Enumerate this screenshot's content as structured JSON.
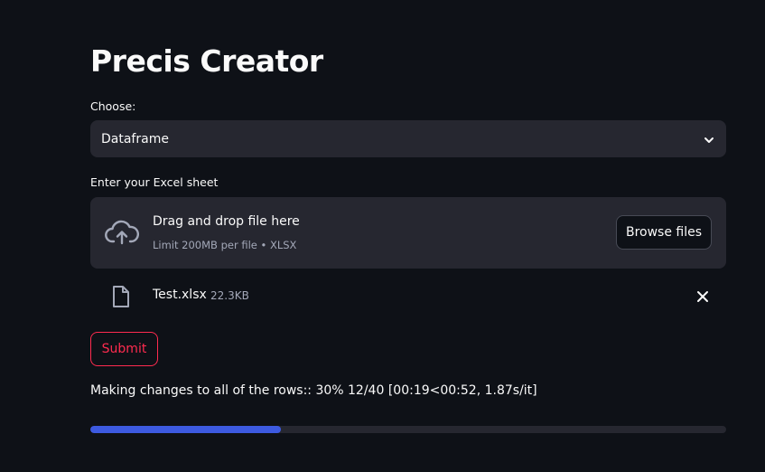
{
  "app": {
    "title": "Precis Creator"
  },
  "choose": {
    "label": "Choose:",
    "selected": "Dataframe",
    "icon": "chevron-down-icon"
  },
  "upload": {
    "label": "Enter your Excel sheet",
    "dropzone_title": "Drag and drop file here",
    "dropzone_limit": "Limit 200MB per file • XLSX",
    "browse_label": "Browse files",
    "icon": "cloud-upload-icon"
  },
  "file": {
    "name": "Test.xlsx",
    "size": "22.3KB",
    "icon": "file-icon",
    "remove_icon": "close-icon"
  },
  "submit": {
    "label": "Submit"
  },
  "progress": {
    "text": "Making changes to all of the rows:: 30% 12/40 [00:19<00:52, 1.87s/it]",
    "fraction": 0.3
  },
  "colors": {
    "background": "#0e1117",
    "surface": "#262730",
    "accent_red": "#ff2b4f",
    "progress_blue": "#3d5ae0"
  }
}
